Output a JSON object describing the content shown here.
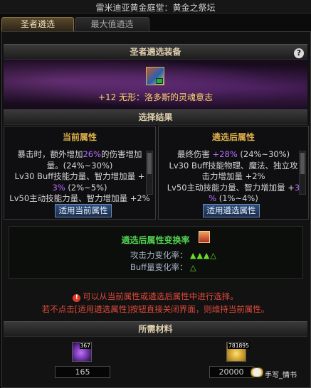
{
  "window": {
    "title": "雷米迪亚黄金庭堂：黄金之祭坛"
  },
  "tabs": [
    {
      "label": "圣者遴选",
      "active": true
    },
    {
      "label": "最大值遴选",
      "active": false
    }
  ],
  "equipment_section": {
    "title": "圣者遴选装备",
    "help": "?",
    "item_name": "+12 无形：洛多斯的灵魂意志"
  },
  "result_section": {
    "title": "选择结果"
  },
  "current_panel": {
    "title": "当前属性",
    "line1_a": "暴击时，额外增加",
    "line1_hl": "26%",
    "line1_b": "的伤害增加",
    "line2": "量。(24%~30%)",
    "line3": "Lv30 Buff技能力量、智力增加量 +",
    "line4_hl": "3%",
    "line4_b": " (2%~5%)",
    "line5": "Lv50主动技能力量、智力增加量 +2%",
    "button": "适用当前属性"
  },
  "selected_panel": {
    "title": "遴选后属性",
    "line1_a": "最终伤害 ",
    "line1_hl": "+28%",
    "line1_b": " (24%~30%)",
    "line2": "Lv30 Buff技能物理、魔法、独立攻",
    "line3": "击力增加量 +2%",
    "line4_a": "Lv50主动技能力量、智力增加量 +",
    "line4_hl": "3",
    "line5_hl": "%",
    "line5_b": " (1%~4%)",
    "button": "适用遴选属性"
  },
  "change_rate": {
    "title": "遴选后属性变换率",
    "attack_label": "攻击力变化率：",
    "attack_value": "▲▲▲△",
    "buff_label": "Buff量变化率：",
    "buff_value": "△"
  },
  "warning": {
    "icon": "!",
    "line1": "可以从当前属性或遴选后属性中进行选择。",
    "line2": "若不点击[适用遴选属性]按钮直接关闭界面，则维持当前属性。"
  },
  "materials": {
    "title": "所需材料",
    "item1": {
      "badge": "367",
      "value": "165"
    },
    "item2": {
      "badge": "781895",
      "value": "20000"
    }
  },
  "watermark": "手写_情书",
  "colors": {
    "accent_gold": "#e0b04a",
    "item_name": "#ffd36a",
    "highlight_purple": "#b86cff",
    "rate_green": "#50d050",
    "warning_red": "#e04a3a"
  }
}
